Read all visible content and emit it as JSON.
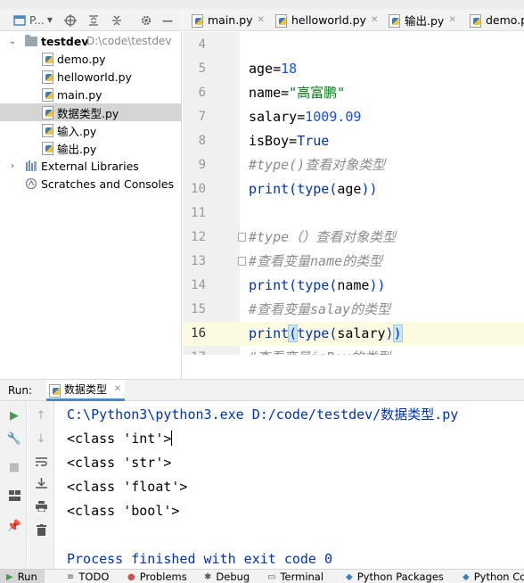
{
  "project_panel": {
    "title": "P...",
    "tree": [
      {
        "label": "testdev",
        "path": "D:\\code\\testdev",
        "kind": "folder",
        "expanded": true
      },
      {
        "label": "demo.py",
        "kind": "py"
      },
      {
        "label": "helloworld.py",
        "kind": "py"
      },
      {
        "label": "main.py",
        "kind": "py"
      },
      {
        "label": "数据类型.py",
        "kind": "py",
        "selected": true
      },
      {
        "label": "输入.py",
        "kind": "py"
      },
      {
        "label": "输出.py",
        "kind": "py"
      },
      {
        "label": "External Libraries",
        "kind": "lib"
      },
      {
        "label": "Scratches and Consoles",
        "kind": "scratch"
      }
    ]
  },
  "editor_tabs": [
    {
      "label": "main.py"
    },
    {
      "label": "helloworld.py"
    },
    {
      "label": "输出.py"
    },
    {
      "label": "demo.py"
    }
  ],
  "editor": {
    "lines": [
      {
        "num": "4",
        "tokens": []
      },
      {
        "num": "5",
        "tokens": [
          [
            "ident",
            "age"
          ],
          [
            "ident",
            "="
          ],
          [
            "num",
            "18"
          ]
        ]
      },
      {
        "num": "6",
        "tokens": [
          [
            "ident",
            "name"
          ],
          [
            "ident",
            "="
          ],
          [
            "str",
            "\"高富鹏\""
          ]
        ]
      },
      {
        "num": "7",
        "tokens": [
          [
            "ident",
            "salary"
          ],
          [
            "ident",
            "="
          ],
          [
            "num",
            "1009.09"
          ]
        ]
      },
      {
        "num": "8",
        "tokens": [
          [
            "ident",
            "isBoy"
          ],
          [
            "ident",
            "="
          ],
          [
            "bool",
            "True"
          ]
        ]
      },
      {
        "num": "9",
        "tokens": [
          [
            "comment",
            "#type()查看对象类型"
          ]
        ]
      },
      {
        "num": "10",
        "tokens": [
          [
            "builtin",
            "print"
          ],
          [
            "builtin",
            "("
          ],
          [
            "builtin",
            "type"
          ],
          [
            "builtin",
            "("
          ],
          [
            "ident",
            "age"
          ],
          [
            "builtin",
            "))"
          ]
        ]
      },
      {
        "num": "11",
        "tokens": []
      },
      {
        "num": "12",
        "tokens": [
          [
            "comment",
            "#type（）查看对象类型"
          ]
        ],
        "fold": true
      },
      {
        "num": "13",
        "tokens": [
          [
            "comment",
            "#查看变量name的类型"
          ]
        ],
        "fold": true
      },
      {
        "num": "14",
        "tokens": [
          [
            "builtin",
            "print"
          ],
          [
            "builtin",
            "("
          ],
          [
            "builtin",
            "type"
          ],
          [
            "builtin",
            "("
          ],
          [
            "ident",
            "name"
          ],
          [
            "builtin",
            "))"
          ]
        ]
      },
      {
        "num": "15",
        "tokens": [
          [
            "comment",
            "#查看变量salay的类型"
          ]
        ]
      },
      {
        "num": "16",
        "tokens": [
          [
            "builtin",
            "print"
          ],
          [
            "bracket",
            "("
          ],
          [
            "builtin",
            "type"
          ],
          [
            "builtin",
            "("
          ],
          [
            "ident",
            "salary"
          ],
          [
            "builtin",
            ")"
          ],
          [
            "bracket",
            ")"
          ]
        ],
        "current": true
      },
      {
        "num": "17",
        "tokens": [
          [
            "comment",
            "#查看变量isBoy的类型"
          ]
        ]
      }
    ]
  },
  "run_panel": {
    "label": "Run:",
    "tab_label": "数据类型",
    "output": [
      "C:\\Python3\\python3.exe D:/code/testdev/数据类型.py",
      "<class 'int'>",
      "<class 'str'>",
      "<class 'float'>",
      "<class 'bool'>",
      "",
      "Process finished with exit code 0"
    ]
  },
  "bottom_bar": [
    {
      "label": "Run",
      "icon": "play-icon",
      "active": true
    },
    {
      "label": "TODO",
      "icon": "list-icon"
    },
    {
      "label": "Problems",
      "icon": "problems-icon"
    },
    {
      "label": "Debug",
      "icon": "bug-icon"
    },
    {
      "label": "Terminal",
      "icon": "terminal-icon"
    },
    {
      "label": "Python Packages",
      "icon": "packages-icon"
    },
    {
      "label": "Python Con",
      "icon": "python-console-icon"
    }
  ]
}
